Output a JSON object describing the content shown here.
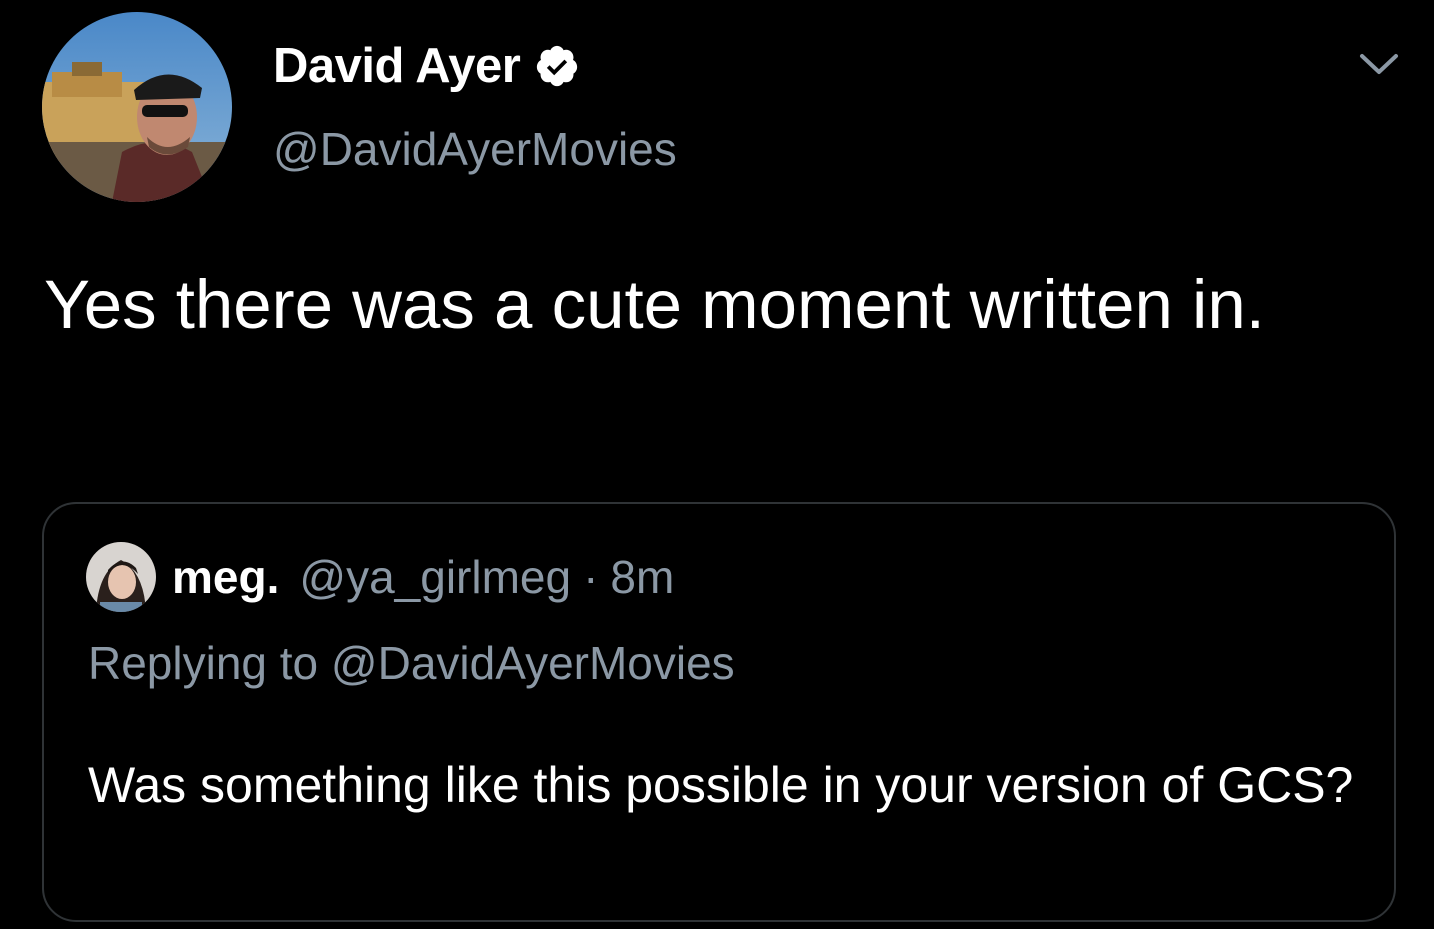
{
  "tweet": {
    "author": {
      "display_name": "David Ayer",
      "handle": "@DavidAyerMovies",
      "verified": true,
      "avatar_icon": "profile-photo"
    },
    "menu_icon": "chevron-down-icon",
    "text": "Yes there was a cute moment written in.",
    "quoted": {
      "author_name": "meg.",
      "author_handle": "@ya_girlmeg",
      "separator": "·",
      "time": "8m",
      "replying_to": "Replying to @DavidAyerMovies",
      "text": "Was something like this possible in your version of GCS?"
    }
  },
  "colors": {
    "background": "#000000",
    "primary_text": "#ffffff",
    "secondary_text": "#8b98a5",
    "border": "#2f3336",
    "verified_badge": "#ffffff"
  }
}
